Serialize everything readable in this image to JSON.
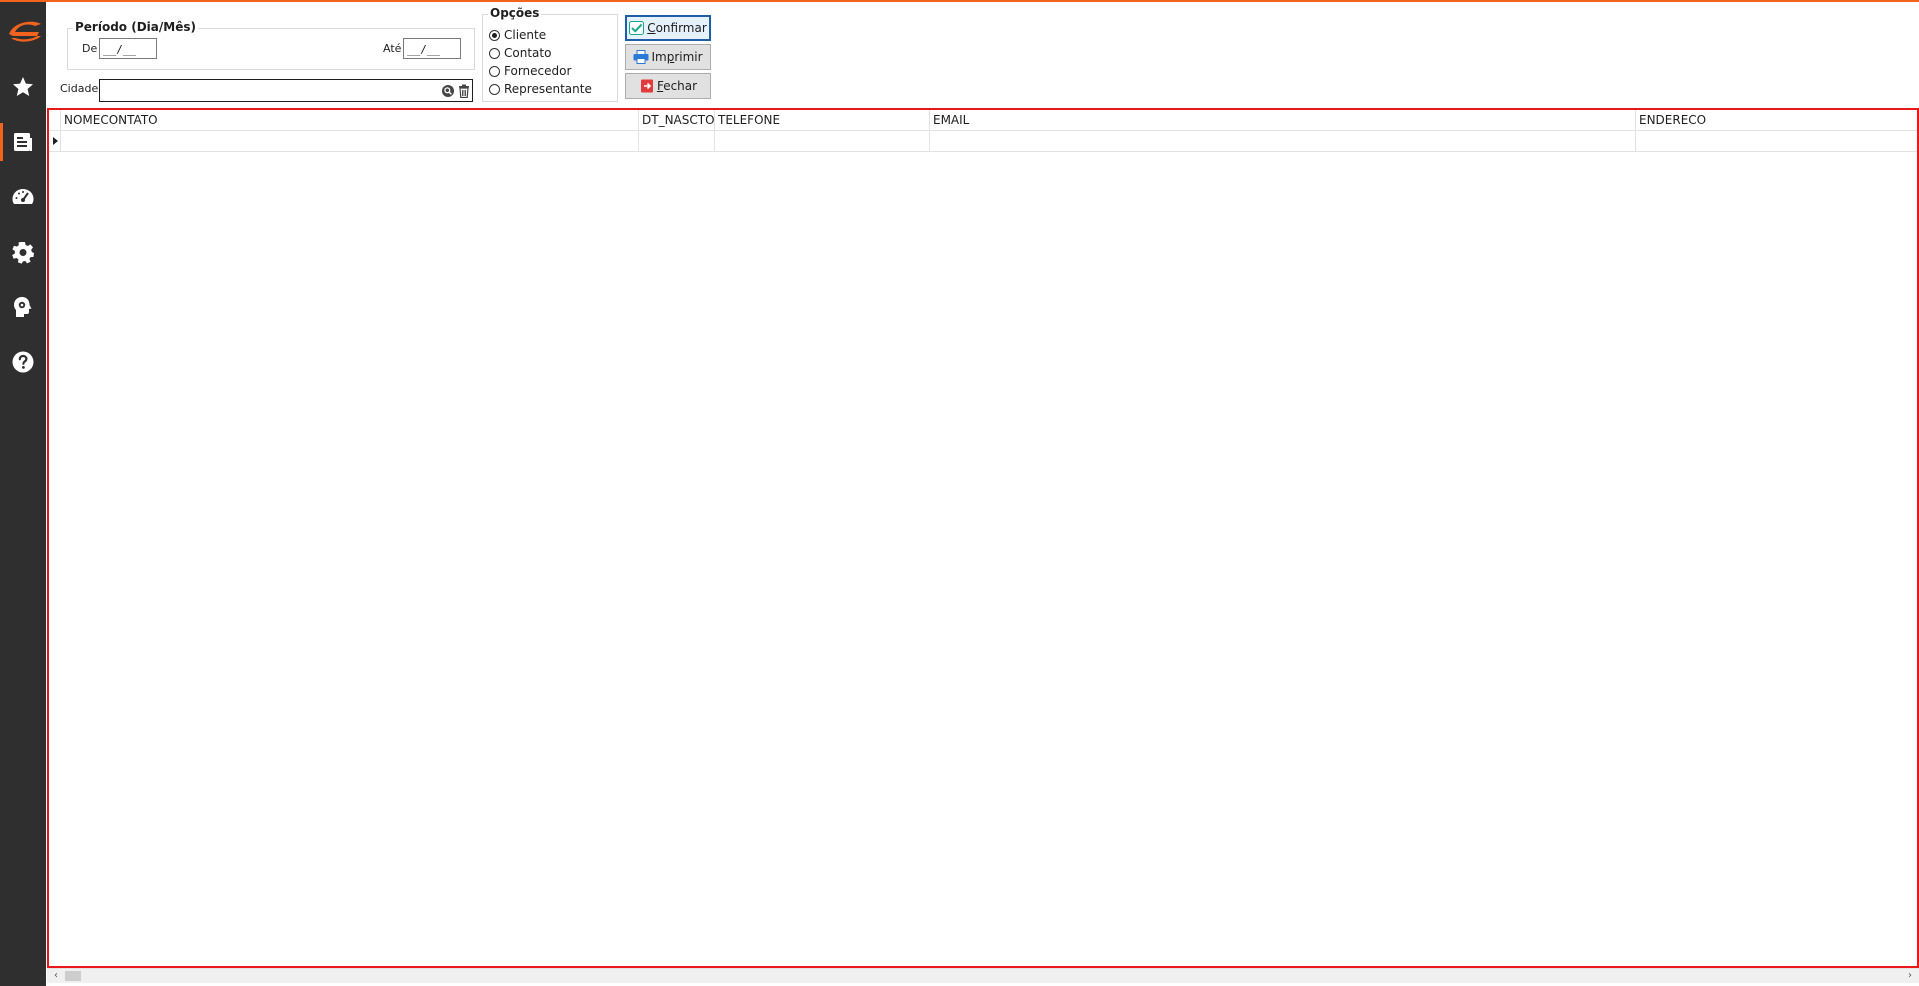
{
  "app": {
    "accent_color": "#f4631d",
    "sidebar_bg": "#2f2f2f"
  },
  "sidebar": {
    "logo_icon": "brand-logo-icon",
    "items": [
      {
        "id": "favorites",
        "icon": "star-icon"
      },
      {
        "id": "reports",
        "icon": "report-icon",
        "active": true
      },
      {
        "id": "dashboard",
        "icon": "speedometer-icon"
      },
      {
        "id": "settings",
        "icon": "gear-icon"
      },
      {
        "id": "intelligence",
        "icon": "head-gear-icon"
      },
      {
        "id": "help",
        "icon": "help-icon"
      }
    ]
  },
  "filters": {
    "period": {
      "legend": "Período (Dia/Mês)",
      "from_label": "De",
      "from_value": "__/__",
      "to_label": "Até",
      "to_value": "__/__"
    },
    "city": {
      "label": "Cidade",
      "value": "",
      "search_icon": "search-icon",
      "clear_icon": "trash-icon"
    },
    "options": {
      "legend": "Opções",
      "items": [
        {
          "label": "Cliente",
          "checked": true
        },
        {
          "label": "Contato",
          "checked": false
        },
        {
          "label": "Fornecedor",
          "checked": false
        },
        {
          "label": "Representante",
          "checked": false
        }
      ]
    }
  },
  "actions": {
    "confirm": {
      "accel": "C",
      "rest": "onfirmar",
      "icon": "check-icon"
    },
    "print": {
      "pre": "Im",
      "accel": "p",
      "rest": "rimir",
      "icon": "printer-icon"
    },
    "close": {
      "accel": "F",
      "rest": "echar",
      "icon": "exit-icon"
    }
  },
  "grid": {
    "border_color": "#e81818",
    "columns": [
      "NOMECONTATO",
      "DT_NASCTO",
      "TELEFONE",
      "EMAIL",
      "ENDERECO"
    ],
    "rows": [
      [
        "",
        "",
        "",
        "",
        ""
      ]
    ]
  }
}
